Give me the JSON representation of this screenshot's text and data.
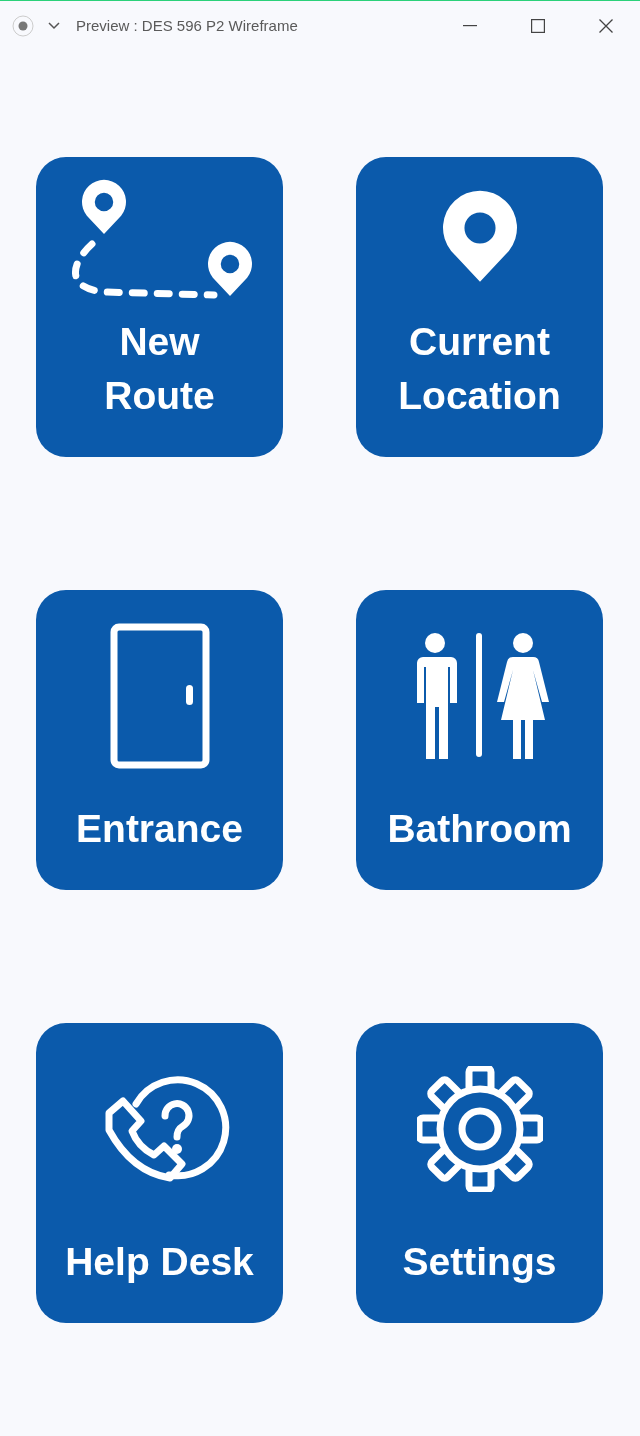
{
  "window": {
    "title": "Preview : DES 596 P2 Wireframe"
  },
  "tiles": [
    {
      "kind": "route",
      "label": "New\nRoute"
    },
    {
      "kind": "pin",
      "label": "Current Location"
    },
    {
      "kind": "door",
      "label": "Entrance"
    },
    {
      "kind": "restroom",
      "label": "Bathroom"
    },
    {
      "kind": "help",
      "label": "Help Desk"
    },
    {
      "kind": "gear",
      "label": "Settings"
    }
  ]
}
